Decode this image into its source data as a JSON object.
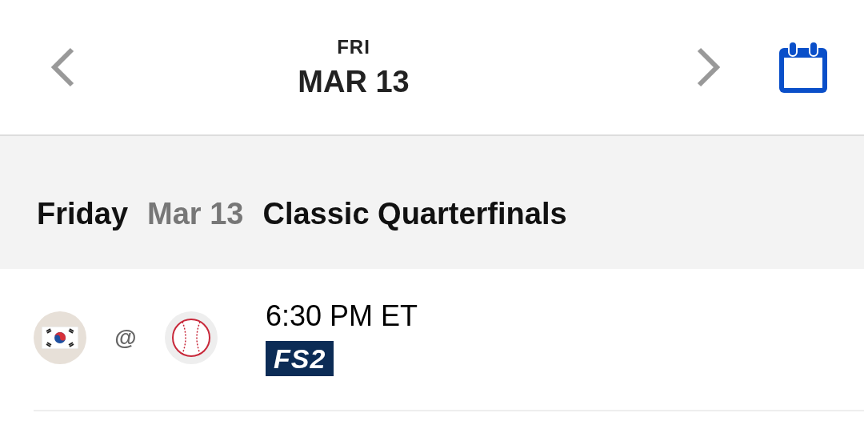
{
  "date_nav": {
    "day": "FRI",
    "date": "MAR 13"
  },
  "section": {
    "weekday": "Friday",
    "date": "Mar 13",
    "title": "Classic Quarterfinals"
  },
  "games": [
    {
      "separator": "@",
      "time": "6:30 PM ET",
      "network": "FS2"
    }
  ]
}
